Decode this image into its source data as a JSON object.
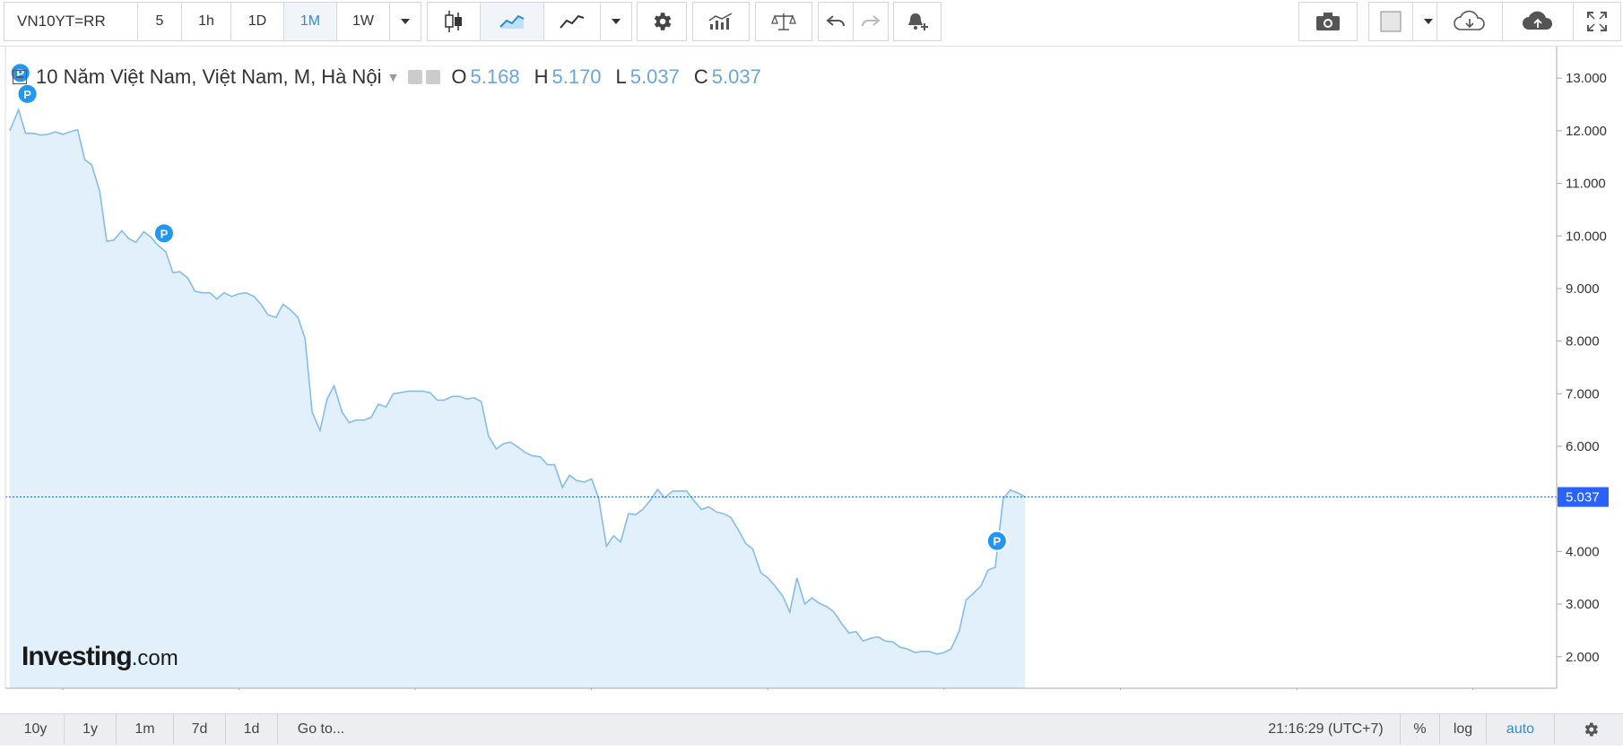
{
  "toolbar": {
    "symbol": "VN10YT=RR",
    "intervals": [
      "5",
      "1h",
      "1D",
      "1M",
      "1W"
    ],
    "active_interval": "1M"
  },
  "legend": {
    "title": "10 Năm Việt Nam, Việt Nam, M, Hà Nội",
    "open_label": "O",
    "open": "5.168",
    "high_label": "H",
    "high": "5.170",
    "low_label": "L",
    "low": "5.037",
    "close_label": "C",
    "close": "5.037"
  },
  "logo": {
    "brand": "Investing",
    "suffix": ".com"
  },
  "bottombar": {
    "ranges": [
      "10y",
      "1y",
      "1m",
      "7d",
      "1d"
    ],
    "goto": "Go to...",
    "time": "21:16:29 (UTC+7)",
    "percent": "%",
    "log": "log",
    "auto": "auto"
  },
  "colors": {
    "line": "#85bde8",
    "fill": "#e1f0fa",
    "price_tag": "#2962ff",
    "marker": "#2196f3"
  },
  "chart_data": {
    "type": "area",
    "ylim": [
      1.4,
      13.6
    ],
    "xlim": [
      2011.35,
      2028.95
    ],
    "y_ticks": [
      "2.000",
      "3.000",
      "4.000",
      "5.000",
      "6.000",
      "7.000",
      "8.000",
      "9.000",
      "10.000",
      "11.000",
      "12.000",
      "13.000"
    ],
    "x_ticks": [
      "2012",
      "2014",
      "2016",
      "2018",
      "2020",
      "2022",
      "2024",
      "2026",
      "2028"
    ],
    "last_price": "5.037",
    "markers": [
      {
        "label": "P",
        "x": 2011.52,
        "y": 13.1
      },
      {
        "label": "P",
        "x": 2011.6,
        "y": 12.7
      },
      {
        "label": "P",
        "x": 2013.15,
        "y": 10.05
      },
      {
        "label": "P",
        "x": 2022.6,
        "y": 4.2
      }
    ],
    "series": [
      {
        "x": [
          2011.4,
          2011.5,
          2011.58,
          2011.67,
          2011.75,
          2011.83,
          2011.92,
          2012.0,
          2012.08,
          2012.17,
          2012.25,
          2012.33,
          2012.42,
          2012.5,
          2012.58,
          2012.67,
          2012.75,
          2012.83,
          2012.92,
          2013.0,
          2013.08,
          2013.17,
          2013.25,
          2013.33,
          2013.42,
          2013.5,
          2013.58,
          2013.67,
          2013.75,
          2013.83,
          2013.92,
          2014.0,
          2014.08,
          2014.17,
          2014.25,
          2014.33,
          2014.42,
          2014.5,
          2014.58,
          2014.67,
          2014.75,
          2014.83,
          2014.92,
          2015.0,
          2015.08,
          2015.17,
          2015.25,
          2015.33,
          2015.42,
          2015.5,
          2015.58,
          2015.67,
          2015.75,
          2015.83,
          2015.92,
          2016.0,
          2016.08,
          2016.17,
          2016.25,
          2016.33,
          2016.42,
          2016.5,
          2016.58,
          2016.67,
          2016.75,
          2016.83,
          2016.92,
          2017.0,
          2017.08,
          2017.17,
          2017.25,
          2017.33,
          2017.42,
          2017.5,
          2017.58,
          2017.67,
          2017.75,
          2017.83,
          2017.92,
          2018.0,
          2018.08,
          2018.17,
          2018.25,
          2018.33,
          2018.42,
          2018.5,
          2018.58,
          2018.67,
          2018.75,
          2018.83,
          2018.92,
          2019.0,
          2019.08,
          2019.17,
          2019.25,
          2019.33,
          2019.42,
          2019.5,
          2019.58,
          2019.67,
          2019.75,
          2019.83,
          2019.92,
          2020.0,
          2020.08,
          2020.17,
          2020.25,
          2020.33,
          2020.42,
          2020.5,
          2020.58,
          2020.67,
          2020.75,
          2020.83,
          2020.92,
          2021.0,
          2021.08,
          2021.17,
          2021.25,
          2021.33,
          2021.42,
          2021.5,
          2021.58,
          2021.67,
          2021.75,
          2021.83,
          2021.92,
          2022.0,
          2022.08,
          2022.17,
          2022.25,
          2022.33,
          2022.42,
          2022.5,
          2022.58,
          2022.67,
          2022.75,
          2022.83,
          2022.92
        ],
        "values": [
          12.0,
          12.4,
          11.95,
          11.95,
          11.92,
          11.93,
          11.98,
          11.93,
          11.98,
          12.02,
          11.45,
          11.35,
          10.85,
          9.9,
          9.92,
          10.1,
          9.95,
          9.88,
          10.08,
          9.98,
          9.82,
          9.7,
          9.3,
          9.32,
          9.2,
          8.95,
          8.92,
          8.92,
          8.8,
          8.92,
          8.85,
          8.9,
          8.92,
          8.85,
          8.7,
          8.5,
          8.45,
          8.7,
          8.6,
          8.45,
          8.05,
          6.65,
          6.3,
          6.9,
          7.15,
          6.65,
          6.45,
          6.5,
          6.5,
          6.55,
          6.8,
          6.75,
          7.0,
          7.02,
          7.05,
          7.05,
          7.05,
          7.02,
          6.88,
          6.88,
          6.95,
          6.95,
          6.9,
          6.92,
          6.85,
          6.2,
          5.95,
          6.05,
          6.08,
          5.98,
          5.88,
          5.82,
          5.8,
          5.65,
          5.65,
          5.22,
          5.45,
          5.35,
          5.32,
          5.38,
          5.02,
          4.1,
          4.3,
          4.18,
          4.72,
          4.7,
          4.8,
          4.98,
          5.18,
          5.02,
          5.15,
          5.15,
          5.15,
          4.95,
          4.8,
          4.85,
          4.75,
          4.72,
          4.65,
          4.4,
          4.15,
          4.05,
          3.6,
          3.5,
          3.35,
          3.15,
          2.85,
          3.5,
          3.0,
          3.12,
          3.02,
          2.95,
          2.85,
          2.65,
          2.45,
          2.48,
          2.3,
          2.35,
          2.38,
          2.3,
          2.28,
          2.18,
          2.15,
          2.08,
          2.1,
          2.1,
          2.05,
          2.08,
          2.15,
          2.48,
          3.08,
          3.2,
          3.35,
          3.65,
          3.7,
          5.0,
          5.17,
          5.12,
          5.04
        ]
      }
    ]
  }
}
